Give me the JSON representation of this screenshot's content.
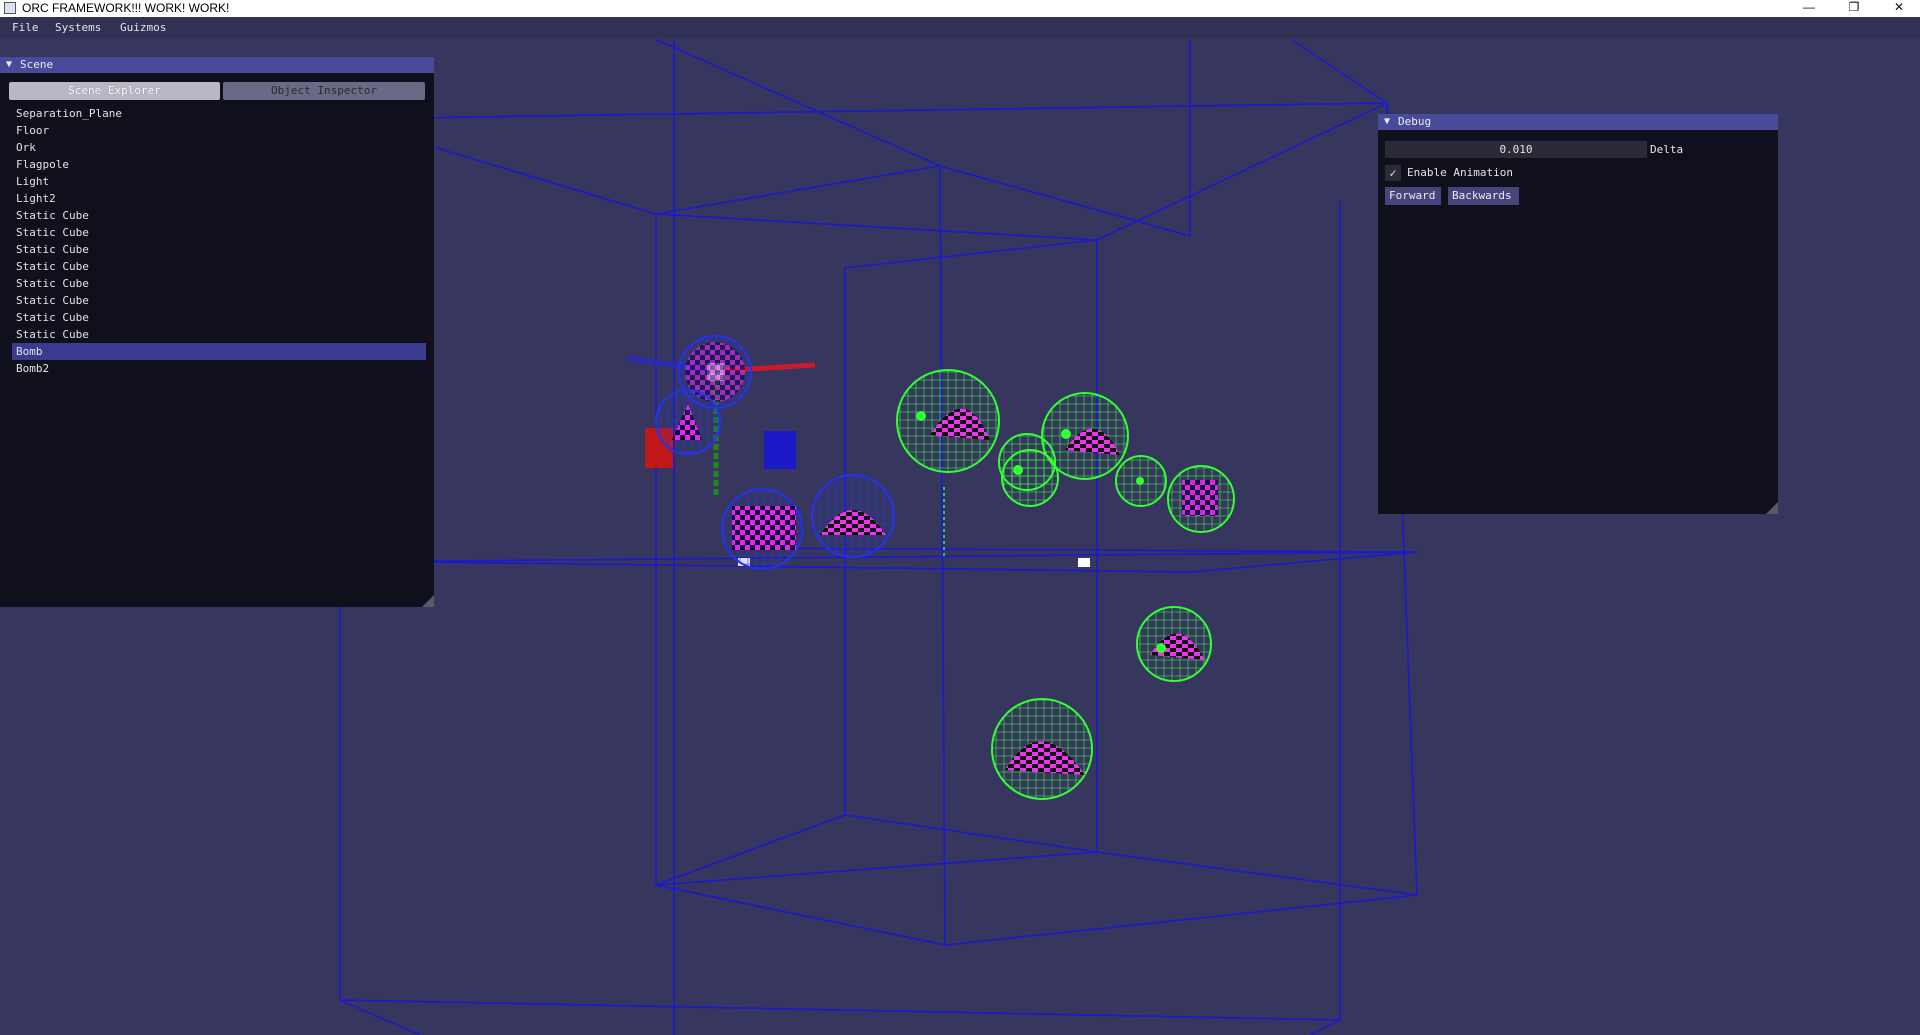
{
  "window": {
    "title": "ORC FRAMEWORK!!! WORK! WORK!",
    "controls": [
      "—",
      "❐",
      "✕"
    ]
  },
  "menu": {
    "items": [
      "File",
      "Systems",
      "Guizmos"
    ]
  },
  "scene_panel": {
    "title": "Scene",
    "tabs": [
      "Scene Explorer",
      "Object Inspector"
    ],
    "active_tab": "Scene Explorer",
    "items": [
      "Separation_Plane",
      "Floor",
      "Ork",
      "Flagpole",
      "Light",
      "Light2",
      "Static Cube",
      "Static Cube",
      "Static Cube",
      "Static Cube",
      "Static Cube",
      "Static Cube",
      "Static Cube",
      "Static Cube",
      "Bomb",
      "Bomb2"
    ],
    "selected_item": "Bomb"
  },
  "debug_panel": {
    "title": "Debug",
    "delta_value": "0.010",
    "delta_label": "Delta",
    "enable_animation_label": "Enable Animation",
    "enable_animation_checked": true,
    "forward_label": "Forward",
    "backwards_label": "Backwards"
  },
  "colors": {
    "background": "#36365f",
    "wireframe": "#1a1ad0",
    "panel": "#10101c",
    "header": "#4a4a9b",
    "selection": "#3a3a8e",
    "gizmo_x": "#cc1a2a",
    "gizmo_y": "#1a8a1a",
    "gizmo_z": "#2a2ab8",
    "sphere_green": "#33ff33",
    "sphere_blue": "#2233ee",
    "checker_magenta": "#ee22ee"
  }
}
